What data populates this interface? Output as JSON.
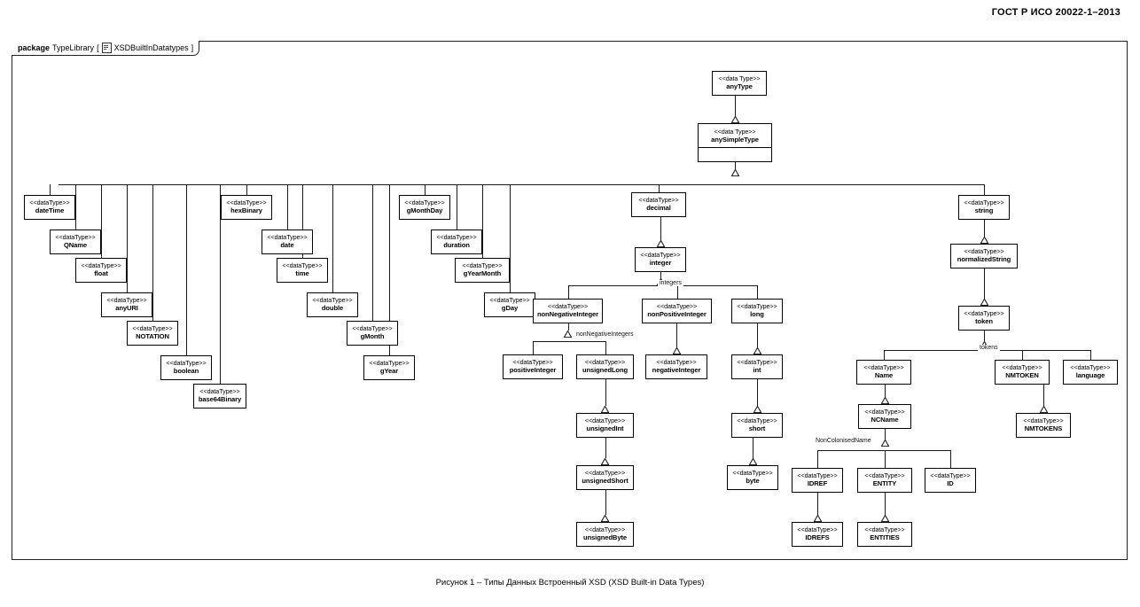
{
  "document": {
    "header": "ГОСТ Р ИСО 20022-1–2013",
    "caption": "Рисунок 1 – Типы Данных Встроенный XSD (XSD Built-in Data Types)"
  },
  "package": {
    "keyword": "package",
    "name": "TypeLibrary",
    "bracket_open": "[",
    "icon": "document-icon",
    "diagram_name": "XSDBuiltInDatatypes",
    "bracket_close": "]"
  },
  "stereotype": "<<dataType>>",
  "stereotype_spaced": "<<data Type>>",
  "nodes": {
    "anyType": "anyType",
    "anySimpleType": "anySimpleType",
    "dateTime": "dateTime",
    "QName": "QName",
    "float": "float",
    "anyURI": "anyURI",
    "NOTATION": "NOTATION",
    "boolean": "boolean",
    "base64Binary": "base64Binary",
    "hexBinary": "hexBinary",
    "date": "date",
    "time": "time",
    "double": "double",
    "gMonth": "gMonth",
    "gYear": "gYear",
    "gMonthDay": "gMonthDay",
    "duration": "duration",
    "gYearMonth": "gYearMonth",
    "gDay": "gDay",
    "decimal": "decimal",
    "integer": "integer",
    "nonNegativeInteger": "nonNegativeInteger",
    "nonPositiveInteger": "nonPositiveInteger",
    "long": "long",
    "positiveInteger": "positiveInteger",
    "unsignedLong": "unsignedLong",
    "negativeInteger": "negativeInteger",
    "int": "int",
    "unsignedInt": "unsignedInt",
    "short": "short",
    "unsignedShort": "unsignedShort",
    "byte": "byte",
    "unsignedByte": "unsignedByte",
    "string": "string",
    "normalizedString": "normalizedString",
    "token": "token",
    "Name": "Name",
    "NMTOKEN": "NMTOKEN",
    "language": "language",
    "NCName": "NCName",
    "NMTOKENS": "NMTOKENS",
    "IDREF": "IDREF",
    "ENTITY": "ENTITY",
    "ID": "ID",
    "IDREFS": "IDREFS",
    "ENTITIES": "ENTITIES"
  },
  "edge_labels": {
    "integers": "integers",
    "nonNegativeIntegers": "nonNegativeIntegers",
    "tokens": "tokens",
    "nonColonisedName": "NonColonisedName"
  },
  "colors": {
    "line": "#1a1a1a",
    "box_border": "#000000",
    "background": "#ffffff"
  }
}
